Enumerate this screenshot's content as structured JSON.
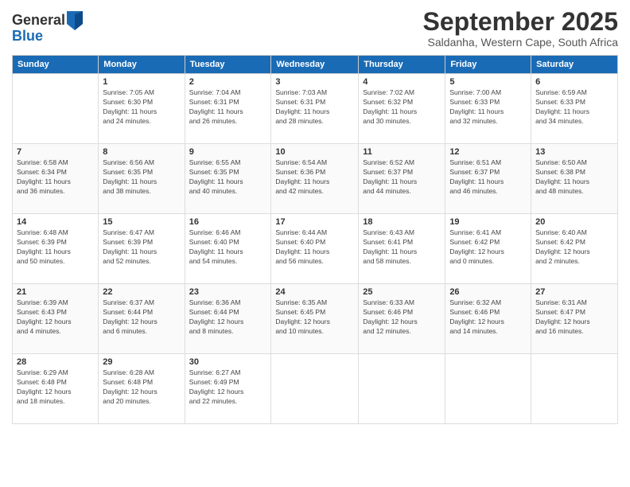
{
  "logo": {
    "general": "General",
    "blue": "Blue"
  },
  "header": {
    "month": "September 2025",
    "location": "Saldanha, Western Cape, South Africa"
  },
  "weekdays": [
    "Sunday",
    "Monday",
    "Tuesday",
    "Wednesday",
    "Thursday",
    "Friday",
    "Saturday"
  ],
  "weeks": [
    [
      {
        "day": "",
        "info": ""
      },
      {
        "day": "1",
        "info": "Sunrise: 7:05 AM\nSunset: 6:30 PM\nDaylight: 11 hours\nand 24 minutes."
      },
      {
        "day": "2",
        "info": "Sunrise: 7:04 AM\nSunset: 6:31 PM\nDaylight: 11 hours\nand 26 minutes."
      },
      {
        "day": "3",
        "info": "Sunrise: 7:03 AM\nSunset: 6:31 PM\nDaylight: 11 hours\nand 28 minutes."
      },
      {
        "day": "4",
        "info": "Sunrise: 7:02 AM\nSunset: 6:32 PM\nDaylight: 11 hours\nand 30 minutes."
      },
      {
        "day": "5",
        "info": "Sunrise: 7:00 AM\nSunset: 6:33 PM\nDaylight: 11 hours\nand 32 minutes."
      },
      {
        "day": "6",
        "info": "Sunrise: 6:59 AM\nSunset: 6:33 PM\nDaylight: 11 hours\nand 34 minutes."
      }
    ],
    [
      {
        "day": "7",
        "info": "Sunrise: 6:58 AM\nSunset: 6:34 PM\nDaylight: 11 hours\nand 36 minutes."
      },
      {
        "day": "8",
        "info": "Sunrise: 6:56 AM\nSunset: 6:35 PM\nDaylight: 11 hours\nand 38 minutes."
      },
      {
        "day": "9",
        "info": "Sunrise: 6:55 AM\nSunset: 6:35 PM\nDaylight: 11 hours\nand 40 minutes."
      },
      {
        "day": "10",
        "info": "Sunrise: 6:54 AM\nSunset: 6:36 PM\nDaylight: 11 hours\nand 42 minutes."
      },
      {
        "day": "11",
        "info": "Sunrise: 6:52 AM\nSunset: 6:37 PM\nDaylight: 11 hours\nand 44 minutes."
      },
      {
        "day": "12",
        "info": "Sunrise: 6:51 AM\nSunset: 6:37 PM\nDaylight: 11 hours\nand 46 minutes."
      },
      {
        "day": "13",
        "info": "Sunrise: 6:50 AM\nSunset: 6:38 PM\nDaylight: 11 hours\nand 48 minutes."
      }
    ],
    [
      {
        "day": "14",
        "info": "Sunrise: 6:48 AM\nSunset: 6:39 PM\nDaylight: 11 hours\nand 50 minutes."
      },
      {
        "day": "15",
        "info": "Sunrise: 6:47 AM\nSunset: 6:39 PM\nDaylight: 11 hours\nand 52 minutes."
      },
      {
        "day": "16",
        "info": "Sunrise: 6:46 AM\nSunset: 6:40 PM\nDaylight: 11 hours\nand 54 minutes."
      },
      {
        "day": "17",
        "info": "Sunrise: 6:44 AM\nSunset: 6:40 PM\nDaylight: 11 hours\nand 56 minutes."
      },
      {
        "day": "18",
        "info": "Sunrise: 6:43 AM\nSunset: 6:41 PM\nDaylight: 11 hours\nand 58 minutes."
      },
      {
        "day": "19",
        "info": "Sunrise: 6:41 AM\nSunset: 6:42 PM\nDaylight: 12 hours\nand 0 minutes."
      },
      {
        "day": "20",
        "info": "Sunrise: 6:40 AM\nSunset: 6:42 PM\nDaylight: 12 hours\nand 2 minutes."
      }
    ],
    [
      {
        "day": "21",
        "info": "Sunrise: 6:39 AM\nSunset: 6:43 PM\nDaylight: 12 hours\nand 4 minutes."
      },
      {
        "day": "22",
        "info": "Sunrise: 6:37 AM\nSunset: 6:44 PM\nDaylight: 12 hours\nand 6 minutes."
      },
      {
        "day": "23",
        "info": "Sunrise: 6:36 AM\nSunset: 6:44 PM\nDaylight: 12 hours\nand 8 minutes."
      },
      {
        "day": "24",
        "info": "Sunrise: 6:35 AM\nSunset: 6:45 PM\nDaylight: 12 hours\nand 10 minutes."
      },
      {
        "day": "25",
        "info": "Sunrise: 6:33 AM\nSunset: 6:46 PM\nDaylight: 12 hours\nand 12 minutes."
      },
      {
        "day": "26",
        "info": "Sunrise: 6:32 AM\nSunset: 6:46 PM\nDaylight: 12 hours\nand 14 minutes."
      },
      {
        "day": "27",
        "info": "Sunrise: 6:31 AM\nSunset: 6:47 PM\nDaylight: 12 hours\nand 16 minutes."
      }
    ],
    [
      {
        "day": "28",
        "info": "Sunrise: 6:29 AM\nSunset: 6:48 PM\nDaylight: 12 hours\nand 18 minutes."
      },
      {
        "day": "29",
        "info": "Sunrise: 6:28 AM\nSunset: 6:48 PM\nDaylight: 12 hours\nand 20 minutes."
      },
      {
        "day": "30",
        "info": "Sunrise: 6:27 AM\nSunset: 6:49 PM\nDaylight: 12 hours\nand 22 minutes."
      },
      {
        "day": "",
        "info": ""
      },
      {
        "day": "",
        "info": ""
      },
      {
        "day": "",
        "info": ""
      },
      {
        "day": "",
        "info": ""
      }
    ]
  ]
}
